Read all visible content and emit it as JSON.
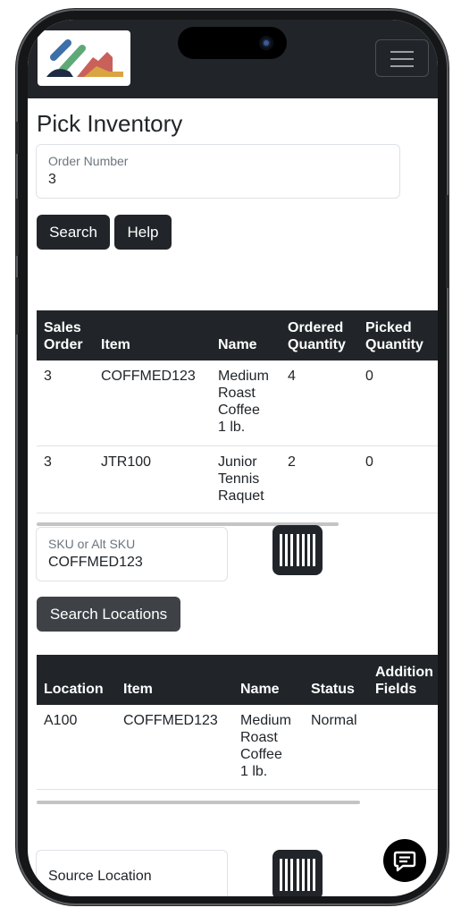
{
  "page": {
    "title": "Pick Inventory"
  },
  "order_field": {
    "label": "Order Number",
    "value": "3"
  },
  "buttons": {
    "search": "Search",
    "help": "Help",
    "search_locations": "Search Locations"
  },
  "order_table": {
    "headers": [
      [
        "Sales",
        "Order"
      ],
      [
        "Item"
      ],
      [
        "Name"
      ],
      [
        "Ordered",
        "Quantity"
      ],
      [
        "Picked",
        "Quantity"
      ]
    ],
    "rows": [
      {
        "sales_order": "3",
        "item": "COFFMED123",
        "name": [
          "Medium",
          "Roast",
          "Coffee",
          "1 lb."
        ],
        "ordered": "4",
        "picked": "0"
      },
      {
        "sales_order": "3",
        "item": "JTR100",
        "name": [
          "Junior",
          "Tennis",
          "Raquet"
        ],
        "ordered": "2",
        "picked": "0"
      }
    ]
  },
  "sku_field": {
    "label": "SKU or Alt SKU",
    "value": "COFFMED123"
  },
  "location_table": {
    "headers": [
      [
        "Location"
      ],
      [
        "Item"
      ],
      [
        "Name"
      ],
      [
        "Status"
      ],
      [
        "Addition",
        "Fields"
      ]
    ],
    "rows": [
      {
        "location": "A100",
        "item": "COFFMED123",
        "name": [
          "Medium",
          "Roast",
          "Coffee",
          "1 lb."
        ],
        "status": "Normal",
        "additional": ""
      }
    ]
  },
  "source_field": {
    "label": "Source Location"
  },
  "icons": {
    "logo": "company-logo-icon",
    "menu": "hamburger-menu-icon",
    "barcode": "barcode-scan-icon",
    "chat": "chat-bubble-icon"
  },
  "colors": {
    "dark": "#212529",
    "border": "#dee2e6",
    "logo_green": "#5fa877",
    "logo_blue": "#3d6fa8",
    "logo_red": "#c9605a",
    "logo_yellow": "#d9a441"
  }
}
